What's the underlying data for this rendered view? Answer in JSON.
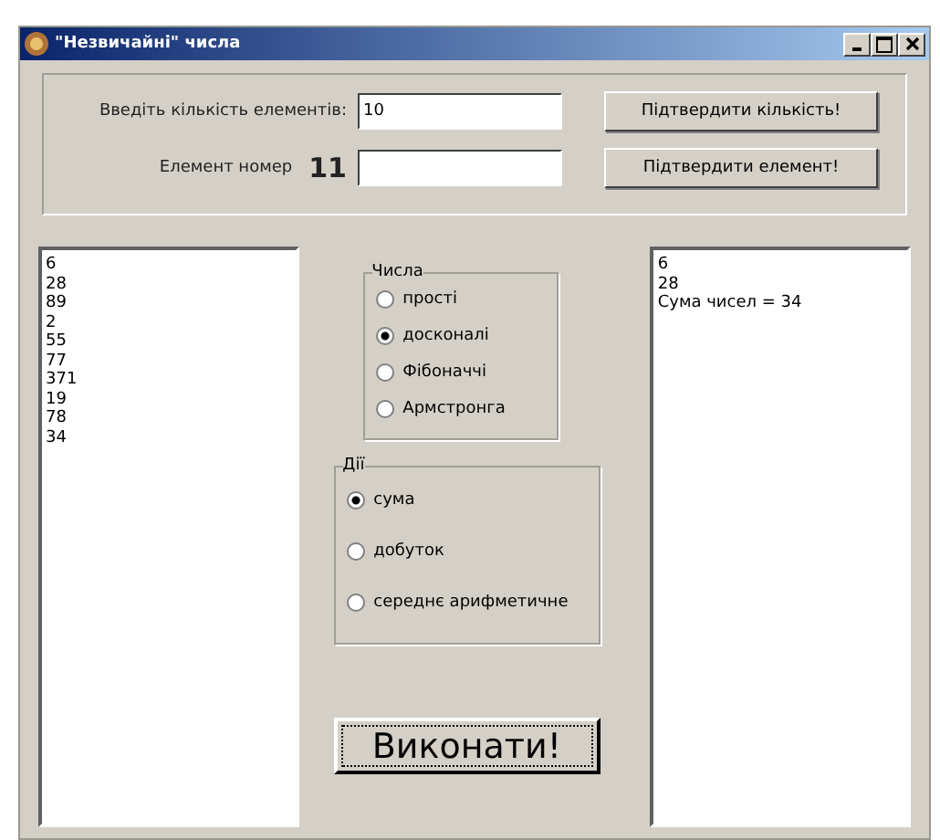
{
  "window": {
    "title": "\"Незвичайні\" числа"
  },
  "count_row": {
    "label": "Введіть кількість елементів:",
    "value": "10",
    "button": "Підтвердити кількість!"
  },
  "element_row": {
    "label": "Елемент номер",
    "number": "11",
    "button": "Підтвердити елемент!"
  },
  "input_list": [
    "6",
    "28",
    "89",
    "2",
    "55",
    "77",
    "371",
    "19",
    "78",
    "34"
  ],
  "numbers_group": {
    "title": "Числа",
    "options": [
      {
        "label": "прості",
        "selected": false
      },
      {
        "label": "досконалі",
        "selected": true
      },
      {
        "label": "Фібоначчі",
        "selected": false
      },
      {
        "label": "Армстронга",
        "selected": false
      }
    ]
  },
  "actions_group": {
    "title": "Дії",
    "options": [
      {
        "label": "сума",
        "selected": true
      },
      {
        "label": "добуток",
        "selected": false
      },
      {
        "label": "середнє арифметичне",
        "selected": false
      }
    ]
  },
  "run_button": "Виконати!",
  "output_list": [
    "6",
    "28",
    "Сума чисел = 34"
  ]
}
